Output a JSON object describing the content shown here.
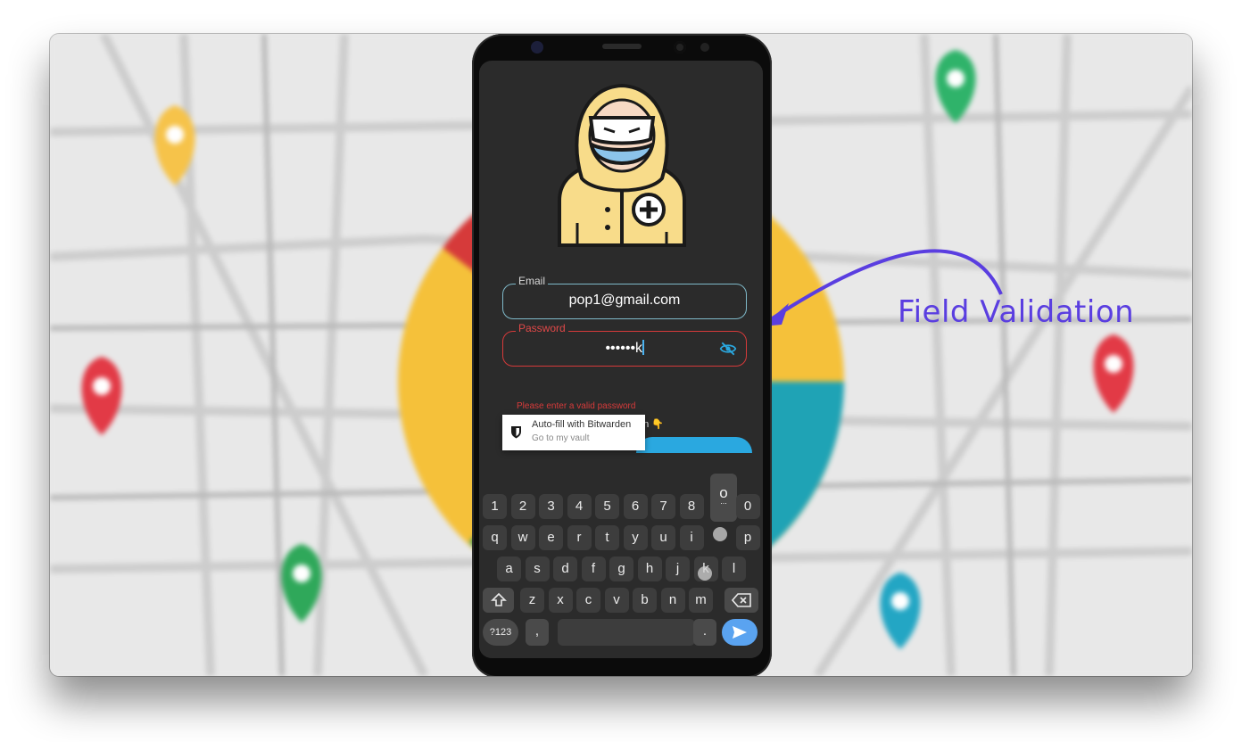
{
  "annotation": {
    "text": "Field Validation",
    "color": "#5a3ee0"
  },
  "form": {
    "email": {
      "label": "Email",
      "value": "pop1@gmail.com"
    },
    "password": {
      "label": "Password",
      "value": "••••••k",
      "error": "Please enter a valid password"
    },
    "login_partial": "on 👇"
  },
  "autofill": {
    "title": "Auto-fill with Bitwarden",
    "subtitle": "Go to my vault"
  },
  "keyboard": {
    "numbers": [
      "1",
      "2",
      "3",
      "4",
      "5",
      "6",
      "7",
      "8",
      "9",
      "0"
    ],
    "row1": [
      "q",
      "w",
      "e",
      "r",
      "t",
      "y",
      "u",
      "i",
      "o",
      "p"
    ],
    "row2": [
      "a",
      "s",
      "d",
      "f",
      "g",
      "h",
      "j",
      "k",
      "l"
    ],
    "row3": [
      "z",
      "x",
      "c",
      "v",
      "b",
      "n",
      "m"
    ],
    "symbols_key": "?123",
    "comma": ",",
    "period": ".",
    "popup": "o",
    "popup_more": "..."
  },
  "colors": {
    "error": "#d63a3a",
    "field_border": "#7fb9c9",
    "accent": "#2aa8e0"
  },
  "icons": [
    "eye-off-icon",
    "bitwarden-shield-icon",
    "shift-icon",
    "backspace-icon",
    "send-icon",
    "chevron-down-icon"
  ]
}
